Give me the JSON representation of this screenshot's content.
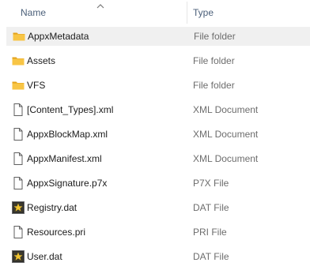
{
  "columns": {
    "name": "Name",
    "type": "Type"
  },
  "files": [
    {
      "name": "AppxMetadata",
      "type": "File folder",
      "icon": "folder-icon",
      "selected": true
    },
    {
      "name": "Assets",
      "type": "File folder",
      "icon": "folder-icon"
    },
    {
      "name": "VFS",
      "type": "File folder",
      "icon": "folder-icon"
    },
    {
      "name": "[Content_Types].xml",
      "type": "XML Document",
      "icon": "document-icon"
    },
    {
      "name": "AppxBlockMap.xml",
      "type": "XML Document",
      "icon": "document-icon"
    },
    {
      "name": "AppxManifest.xml",
      "type": "XML Document",
      "icon": "document-icon"
    },
    {
      "name": "AppxSignature.p7x",
      "type": "P7X File",
      "icon": "document-icon"
    },
    {
      "name": "Registry.dat",
      "type": "DAT File",
      "icon": "dat-file-icon"
    },
    {
      "name": "Resources.pri",
      "type": "PRI File",
      "icon": "document-icon"
    },
    {
      "name": "User.dat",
      "type": "DAT File",
      "icon": "dat-file-icon"
    }
  ],
  "colors": {
    "folder": "#f8c545",
    "folder_dark": "#e3a21a",
    "header_text": "#4c607a",
    "type_text": "#6d6d6d",
    "selected_row": "#f0f0f0"
  }
}
